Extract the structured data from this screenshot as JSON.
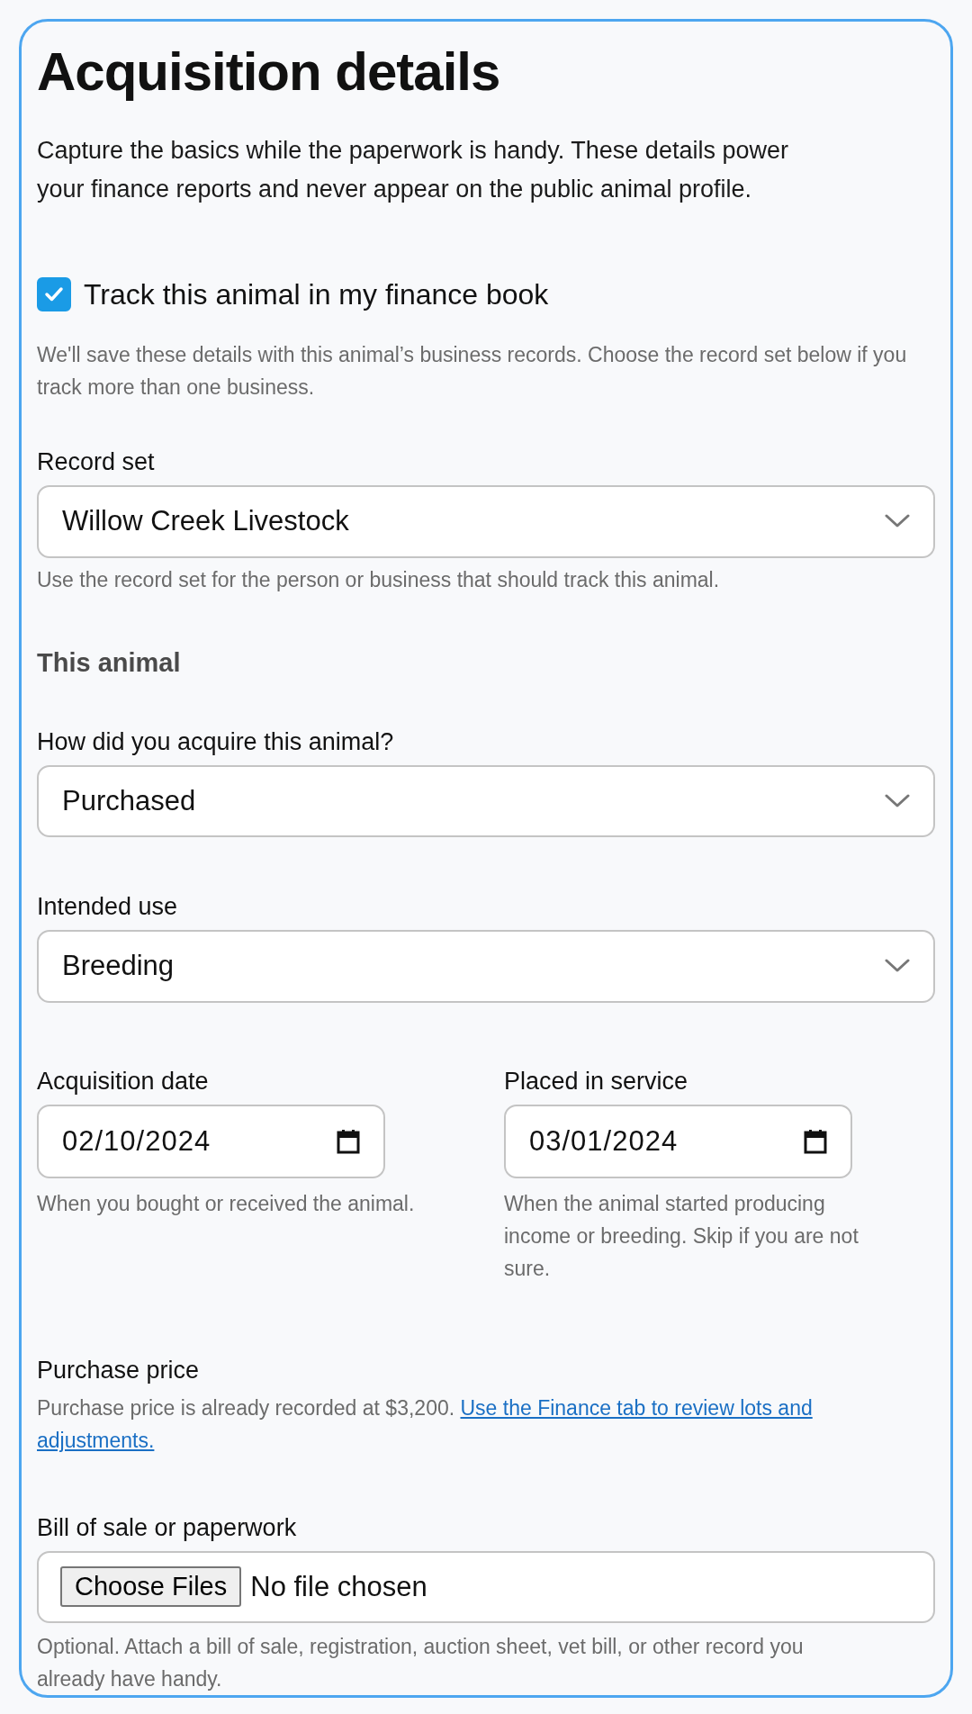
{
  "title": "Acquisition details",
  "intro": "Capture the basics while the paperwork is handy. These details power your finance reports and never appear on the public animal profile.",
  "tracking": {
    "label": "Track this animal in my finance book",
    "checked": true,
    "help": "We'll save these details with this animal’s business records. Choose the record set below if you track more than one business."
  },
  "record_set": {
    "label": "Record set",
    "value": "Willow Creek Livestock",
    "help": "Use the record set for the person or business that should track this animal."
  },
  "section_title": "This animal",
  "selects": [
    {
      "label": "How did you acquire this animal?",
      "value": "Purchased"
    },
    {
      "label": "Intended use",
      "value": "Breeding"
    }
  ],
  "dates": [
    {
      "label": "Acquisition date",
      "value": "02/10/2024",
      "help": "When you bought or received the animal."
    },
    {
      "label": "Placed in service",
      "value": "03/01/2024",
      "help": "When the animal started producing income or breeding. Skip if you are not sure."
    }
  ],
  "purchase_price": {
    "label": "Purchase price",
    "text": "Purchase price is already recorded at $3,200.",
    "link": "Use the Finance tab to review lots and adjustments."
  },
  "paperwork": {
    "label": "Bill of sale or paperwork",
    "button": "Choose Files",
    "status": "No file chosen",
    "help": "Optional. Attach a bill of sale, registration, auction sheet, vet bill, or other record you already have handy."
  }
}
